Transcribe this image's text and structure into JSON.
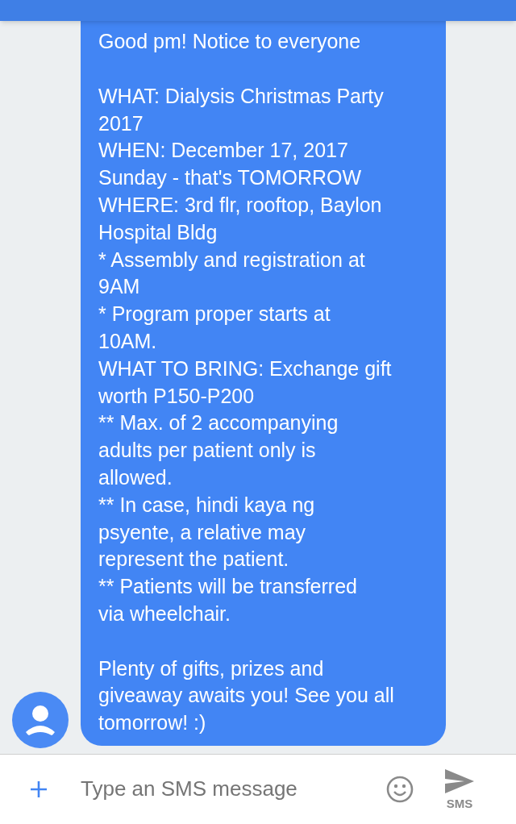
{
  "messages": [
    {
      "paragraphs": [
        [
          "Good pm! Notice to everyone"
        ],
        [
          "WHAT: Dialysis Christmas Party",
          "2017",
          "WHEN: December 17, 2017",
          "Sunday - that's TOMORROW",
          "WHERE: 3rd flr, rooftop, Baylon",
          "Hospital Bldg",
          "* Assembly and registration at",
          "9AM",
          "* Program proper starts at",
          "10AM.",
          "WHAT TO BRING: Exchange gift",
          "worth P150-P200",
          "** Max. of 2 accompanying",
          "adults per patient only is",
          "allowed.",
          "** In case, hindi kaya ng",
          "psyente, a relative may",
          "represent the patient.",
          "** Patients will be transferred",
          "via wheelchair."
        ],
        [
          "Plenty of gifts, prizes and",
          "giveaway awaits you! See you all",
          "tomorrow! :)"
        ]
      ]
    }
  ],
  "composer": {
    "placeholder": "Type an SMS message",
    "send_label": "SMS"
  }
}
